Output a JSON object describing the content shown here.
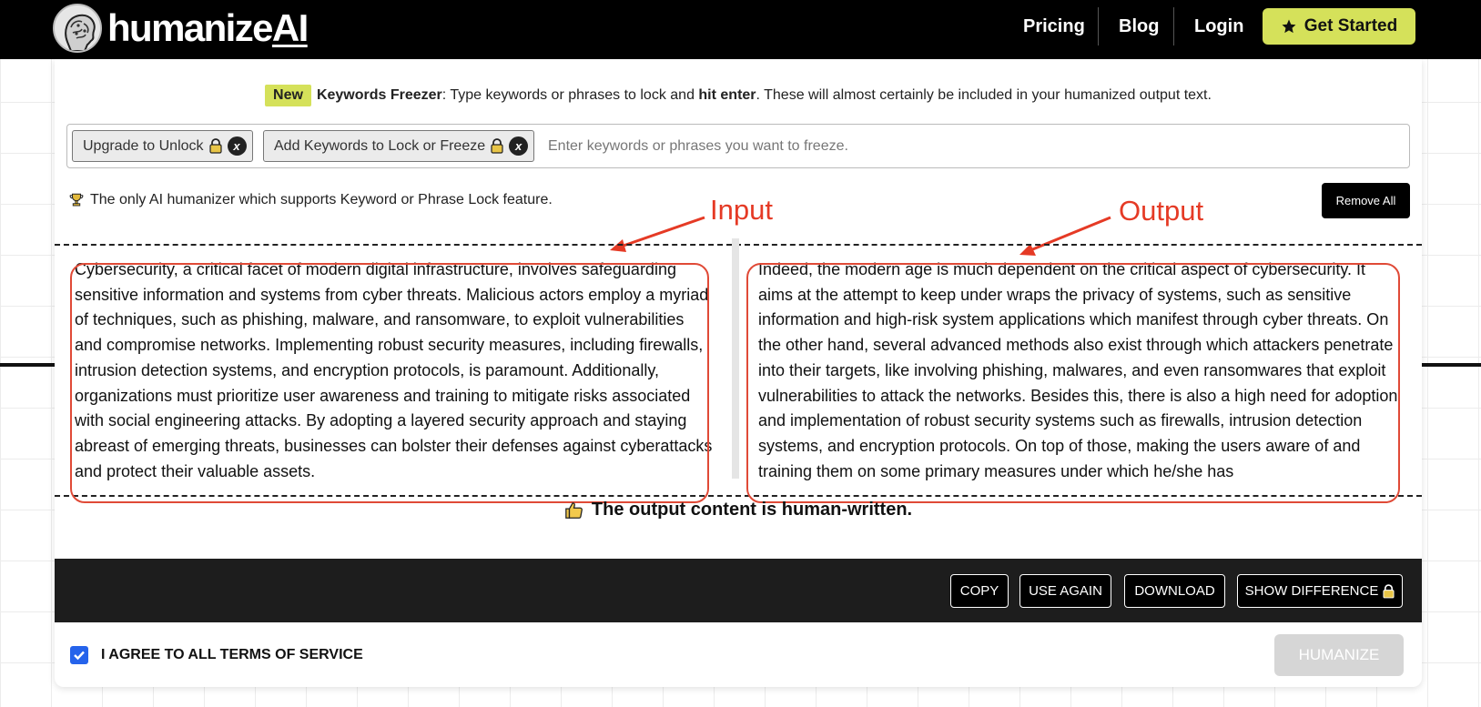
{
  "nav": {
    "logo_main": "humanize",
    "logo_ai": "AI",
    "links": [
      "Pricing",
      "Blog",
      "Login"
    ],
    "cta_label": "Get Started"
  },
  "keywords": {
    "new_badge": "New",
    "feature_name": "Keywords Freezer",
    "desc_1": ": Type keywords or phrases to lock and ",
    "desc_bold": "hit enter",
    "desc_2": ". These will almost certainly be included in your humanized output text.",
    "chip_upgrade": "Upgrade to Unlock",
    "chip_add": "Add Keywords to Lock or Freeze",
    "chip_close": "x",
    "input_placeholder": "Enter keywords or phrases you want to freeze.",
    "lock_note": "The only AI humanizer which supports Keyword or Phrase Lock feature.",
    "remove_all": "Remove All"
  },
  "annotations": {
    "input": "Input",
    "output": "Output"
  },
  "input_text": "Cybersecurity, a critical facet of modern digital infrastructure, involves safeguarding sensitive information and systems from cyber threats. Malicious actors employ a myriad of techniques, such as phishing, malware, and ransomware, to exploit vulnerabilities and compromise networks. Implementing robust security measures, including firewalls, intrusion detection systems, and encryption protocols, is paramount. Additionally, organizations must prioritize user awareness and training to mitigate risks associated with social engineering attacks. By adopting a layered security approach and staying abreast of emerging threats, businesses can bolster their defenses against cyberattacks and protect their valuable assets.",
  "output_text": "Indeed, the modern age is much dependent on the critical aspect of cybersecurity. It aims at the attempt to keep under wraps the privacy of systems, such as sensitive information and high-risk system applications which manifest through cyber threats. On the other hand, several advanced methods also exist through which attackers penetrate into their targets, like involving phishing, malwares, and even ransomwares that exploit vulnerabilities to attack the networks. Besides this, there is also a high need for adoption and implementation of robust security systems such as firewalls, intrusion detection systems, and encryption protocols. On top of those, making the users aware of and training them on some primary measures under which he/she has",
  "status": "The output content is human-written.",
  "actions": {
    "copy": "COPY",
    "use_again": "USE AGAIN",
    "download": "DOWNLOAD",
    "show_difference": "SHOW DIFFERENCE"
  },
  "footer": {
    "agree_label": "I AGREE TO ALL TERMS OF SERVICE",
    "agree_checked": true,
    "humanize": "HUMANIZE"
  },
  "colors": {
    "accent": "#d5e15a",
    "annotation": "#e53a25",
    "checkbox": "#2563eb"
  }
}
